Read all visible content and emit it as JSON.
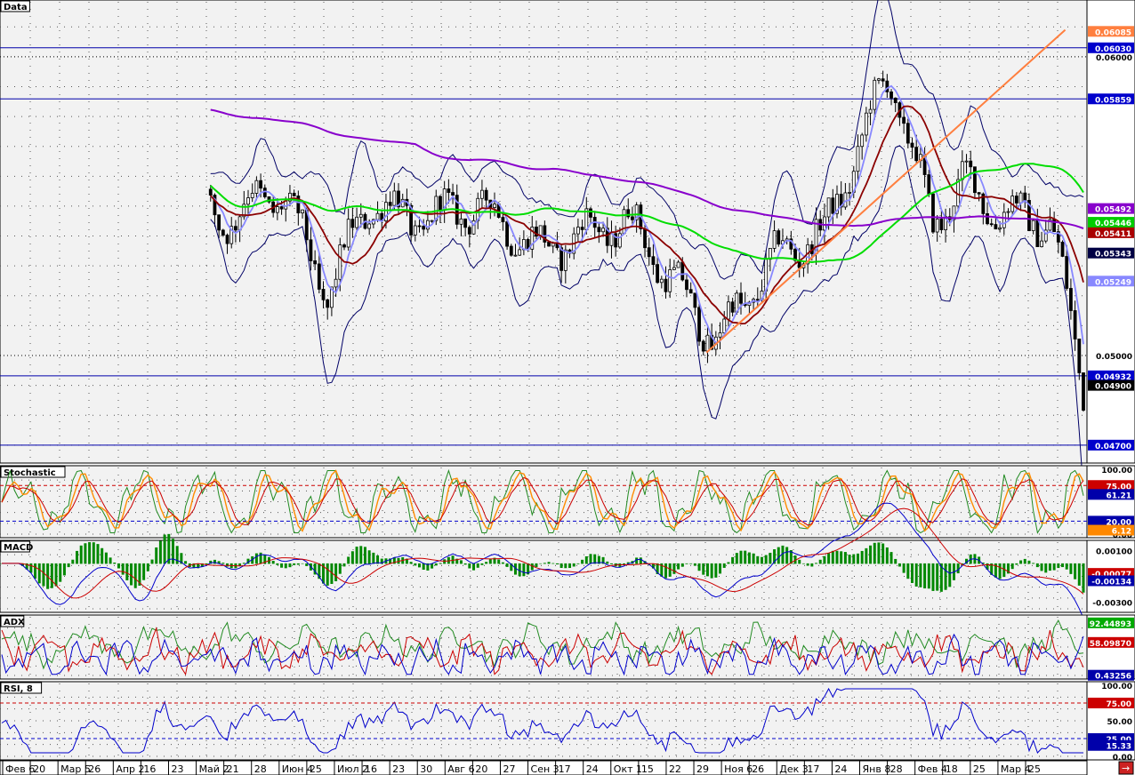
{
  "colors": {
    "background": "#f2f2f2",
    "axis_bg": "#ffffff",
    "grid_dots": "#555555",
    "candle": "#000000",
    "hline": "#0000aa",
    "trend": "#ff7f3f",
    "ma_fast": "#8888ff",
    "ma_mid": "#8b0000",
    "ma_slow": "#00dd00",
    "ma_long": "#8800cc",
    "bands": "#000066"
  },
  "chart_data": [
    {
      "panel": "Data",
      "type": "candlestick",
      "title": "Data",
      "ylim": [
        0.0464,
        0.0619
      ],
      "y_ticks": [
        "0.06000",
        "0.05000"
      ],
      "horizontal_lines": [
        0.0603,
        0.05859,
        0.04932,
        0.047
      ],
      "trend_line": {
        "from": {
          "x": 0.65,
          "y": 0.0501
        },
        "to": {
          "x": 0.98,
          "y": 0.0609
        }
      },
      "price_labels": [
        {
          "text": "0.06085",
          "value": 0.06085,
          "color": "#ff7f3f"
        },
        {
          "text": "0.06030",
          "value": 0.0603,
          "color": "#0000cc"
        },
        {
          "text": "0.05859",
          "value": 0.05859,
          "color": "#0000cc"
        },
        {
          "text": "0.05492",
          "value": 0.05492,
          "color": "#8800cc"
        },
        {
          "text": "0.05446",
          "value": 0.05446,
          "color": "#00cc00"
        },
        {
          "text": "0.05411",
          "value": 0.05411,
          "color": "#aa0000"
        },
        {
          "text": "0.05343",
          "value": 0.05343,
          "color": "#000044"
        },
        {
          "text": "0.05249",
          "value": 0.05249,
          "color": "#8888ff"
        },
        {
          "text": "0.04932",
          "value": 0.04932,
          "color": "#0000cc"
        },
        {
          "text": "0.04900",
          "value": 0.049,
          "color": "#000000"
        },
        {
          "text": "0.04700",
          "value": 0.047,
          "color": "#0000cc"
        }
      ]
    },
    {
      "panel": "Stochastic",
      "type": "line",
      "title": "Stochastic",
      "ylim": [
        0,
        100
      ],
      "y_ticks": [
        "100.00",
        "0.00"
      ],
      "levels": [
        75,
        20
      ],
      "value_labels": [
        {
          "text": "75.00",
          "value": 75,
          "color": "#cc0000"
        },
        {
          "text": "61.21",
          "value": 61.21,
          "color": "#0000aa"
        },
        {
          "text": "20.00",
          "value": 20,
          "color": "#0000aa"
        },
        {
          "text": "6.12",
          "value": 6.12,
          "color": "#ff8800"
        }
      ]
    },
    {
      "panel": "MACD",
      "type": "line",
      "title": "MACD",
      "ylim": [
        -0.0035,
        0.0015
      ],
      "y_ticks": [
        "0.00100",
        "-0.00300"
      ],
      "value_labels": [
        {
          "text": "-0.00077",
          "value": -0.00077,
          "color": "#cc0000"
        },
        {
          "text": "-0.00134",
          "value": -0.00134,
          "color": "#0000aa"
        }
      ]
    },
    {
      "panel": "ADX",
      "type": "line",
      "title": "ADX",
      "ylim": [
        0,
        100
      ],
      "value_labels": [
        {
          "text": "92.44893",
          "value": 92.44893,
          "color": "#00aa00"
        },
        {
          "text": "58.09870",
          "value": 58.0987,
          "color": "#cc0000"
        },
        {
          "text": "0.43256",
          "value": 0.43256,
          "color": "#0000aa"
        }
      ]
    },
    {
      "panel": "RSI",
      "type": "line",
      "title": "RSI, 8",
      "ylim": [
        0,
        100
      ],
      "y_ticks": [
        "100.00",
        "50.00",
        "0.00"
      ],
      "levels": [
        75,
        25
      ],
      "value_labels": [
        {
          "text": "75.00",
          "value": 75,
          "color": "#cc0000"
        },
        {
          "text": "25.00",
          "value": 25,
          "color": "#0000aa"
        },
        {
          "text": "15.33",
          "value": 15.33,
          "color": "#0000aa"
        }
      ]
    }
  ],
  "x_axis": {
    "labels": [
      "Фев 6",
      "20",
      "Мар 5",
      "26",
      "Апр 2",
      "16",
      "23",
      "Май 2",
      "21",
      "28",
      "Июн 4",
      "25",
      "Июл 2",
      "16",
      "23",
      "30",
      "Авг 6",
      "20",
      "27",
      "Сен 3",
      "17",
      "24",
      "Окт 1",
      "15",
      "22",
      "29",
      "Ноя 6",
      "26",
      "Дек 3",
      "17",
      "24",
      "Янв 8",
      "28",
      "Фев 4",
      "18",
      "25",
      "Мар 4",
      "25"
    ]
  },
  "corner_button": {
    "label": "→"
  }
}
